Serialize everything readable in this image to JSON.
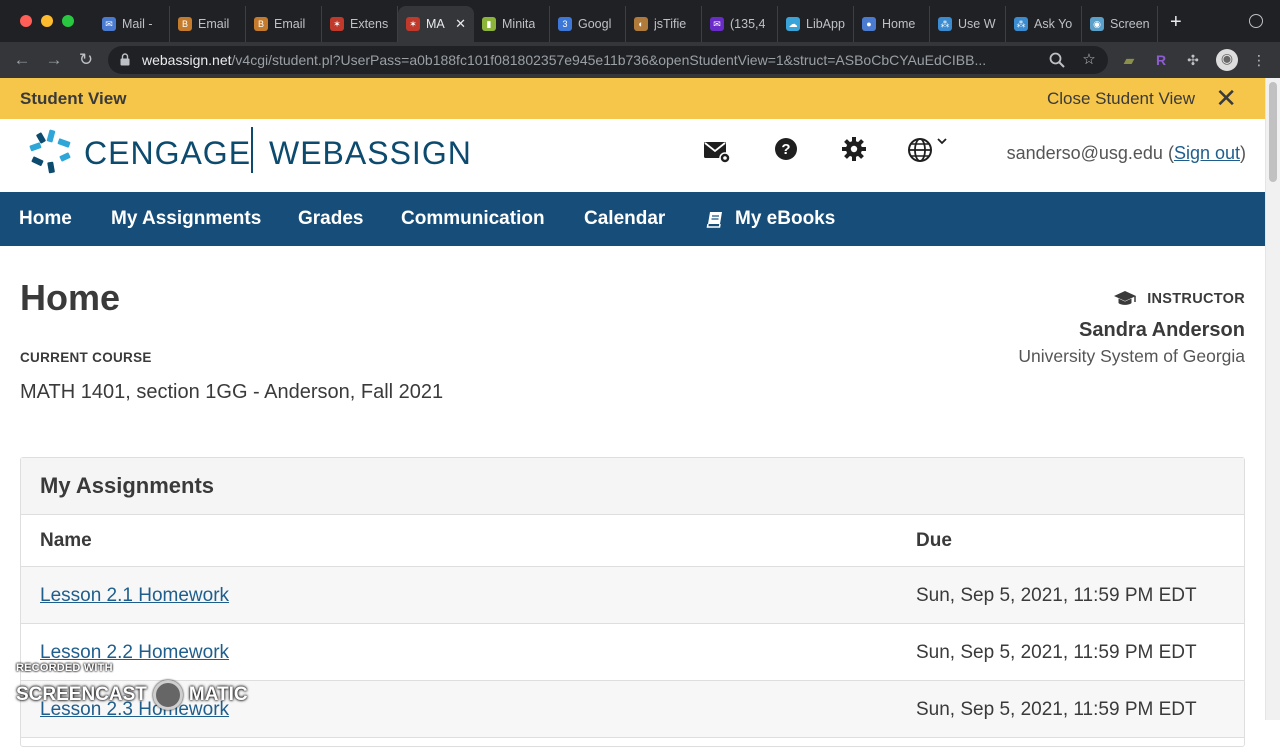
{
  "browser": {
    "tabs": [
      {
        "label": "Mail -",
        "color": "#4a7bd0",
        "glyph": "✉"
      },
      {
        "label": "Email",
        "color": "#c57b2c",
        "glyph": "B"
      },
      {
        "label": "Email",
        "color": "#c57b2c",
        "glyph": "B"
      },
      {
        "label": "Extens",
        "color": "#c0392b",
        "glyph": "✶"
      },
      {
        "label": "MA",
        "color": "#c0392b",
        "glyph": "✶",
        "active": true
      },
      {
        "label": "Minita",
        "color": "#8cb43a",
        "glyph": "▮"
      },
      {
        "label": "Googl",
        "color": "#3d78d8",
        "glyph": "3"
      },
      {
        "label": "jsTifie",
        "color": "#b07a3a",
        "glyph": "◐"
      },
      {
        "label": "(135,4",
        "color": "#6a2cc9",
        "glyph": "✉"
      },
      {
        "label": "LibApp",
        "color": "#3aa3d8",
        "glyph": "☁"
      },
      {
        "label": "Home",
        "color": "#4a7bd0",
        "glyph": "●"
      },
      {
        "label": "Use W",
        "color": "#3a8bd0",
        "glyph": "⁂"
      },
      {
        "label": "Ask Yo",
        "color": "#3a8bd0",
        "glyph": "⁂"
      },
      {
        "label": "Screen",
        "color": "#5aa0c8",
        "glyph": "◉"
      }
    ],
    "url_host": "webassign.net",
    "url_path": "/v4cgi/student.pl?UserPass=a0b188fc101f081802357e945e11b736&openStudentView=1&struct=ASBoCbCYAuEdCIBB..."
  },
  "student_bar": {
    "label": "Student View",
    "close_label": "Close Student View"
  },
  "header": {
    "brand_left": "CENGAGE",
    "brand_right": "WEBASSIGN",
    "user_email": "sanderso@usg.edu",
    "sign_out": "Sign out"
  },
  "nav": {
    "home": "Home",
    "assignments": "My Assignments",
    "grades": "Grades",
    "communication": "Communication",
    "calendar": "Calendar",
    "ebooks": "My eBooks"
  },
  "main": {
    "title": "Home",
    "current_course_label": "CURRENT COURSE",
    "current_course": "MATH 1401, section 1GG - Anderson, Fall 2021",
    "instructor_label": "INSTRUCTOR",
    "instructor_name": "Sandra Anderson",
    "instructor_school": "University System of Georgia"
  },
  "assignments": {
    "heading": "My Assignments",
    "col_name": "Name",
    "col_due": "Due",
    "rows": [
      {
        "name": "Lesson 2.1 Homework",
        "due": "Sun, Sep 5, 2021, 11:59 PM EDT"
      },
      {
        "name": "Lesson 2.2 Homework",
        "due": "Sun, Sep 5, 2021, 11:59 PM EDT"
      },
      {
        "name": "Lesson 2.3 Homework",
        "due": "Sun, Sep 5, 2021, 11:59 PM EDT"
      }
    ]
  },
  "watermark": {
    "top": "RECORDED WITH",
    "left": "SCREENCAST",
    "right": "MATIC"
  }
}
